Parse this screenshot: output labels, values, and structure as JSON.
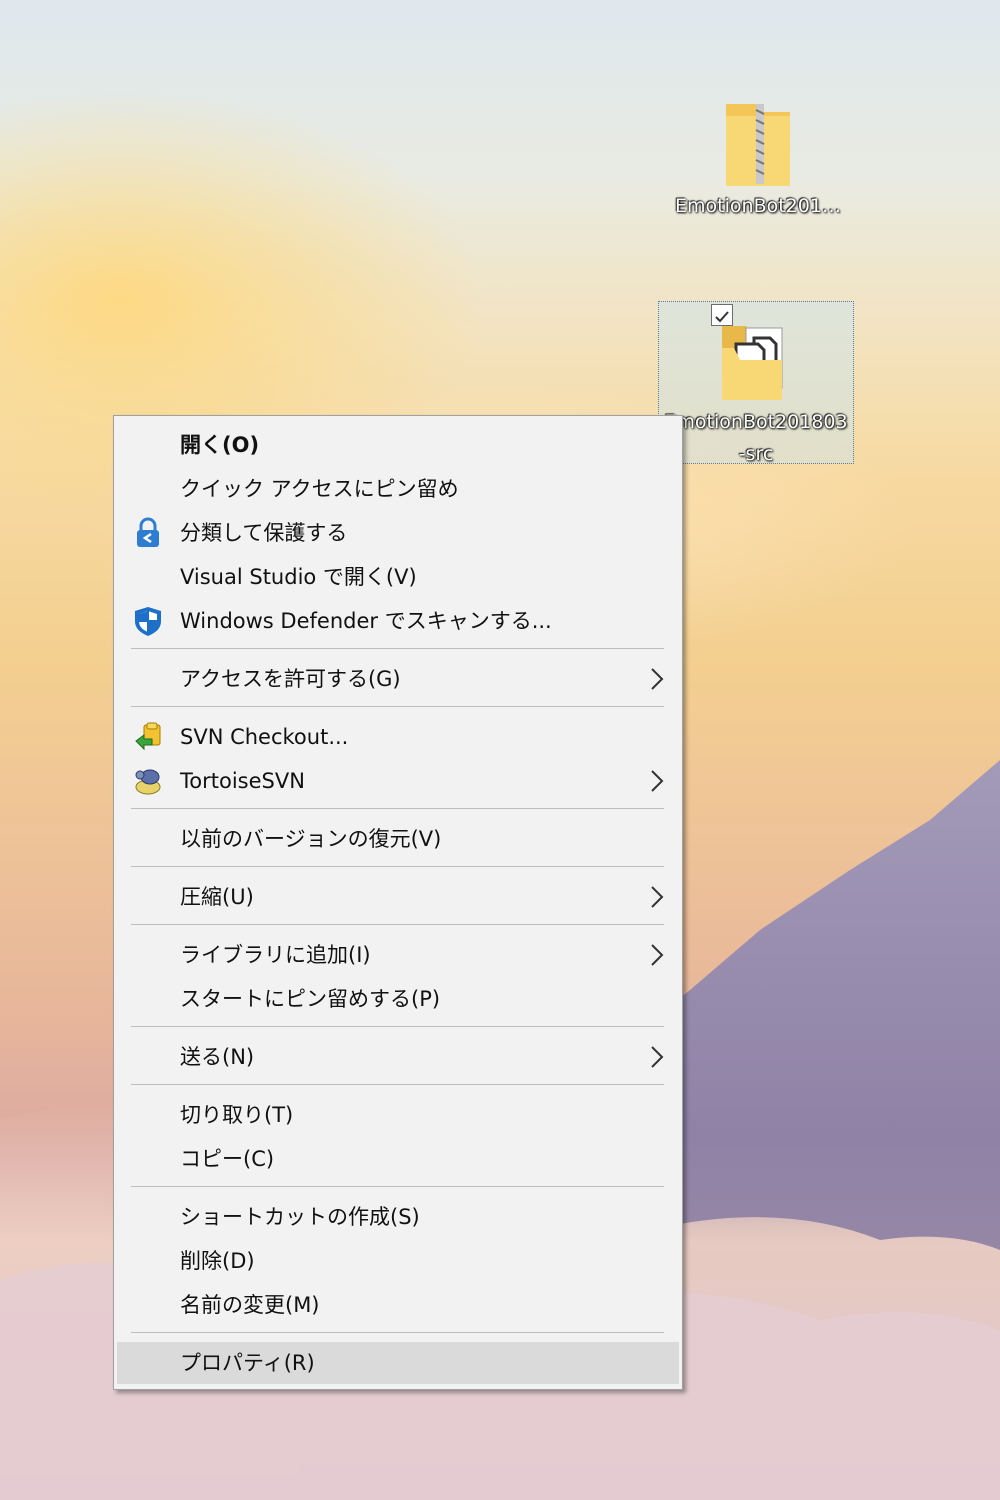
{
  "desktop": {
    "icons": [
      {
        "label": "EmotionBot201…",
        "type": "zip-folder-icon"
      },
      {
        "label": "EmotionBot201803-src",
        "type": "folder-icon",
        "selected": true,
        "checked": true
      }
    ]
  },
  "context_menu": {
    "items": [
      {
        "label": "開く(O)",
        "icon": null,
        "bold": true
      },
      {
        "label": "クイック アクセスにピン留め",
        "icon": null
      },
      {
        "label": "分類して保護する",
        "icon": "lock-protect-icon"
      },
      {
        "label": "Visual Studio で開く(V)",
        "icon": null
      },
      {
        "label": "Windows Defender でスキャンする...",
        "icon": "shield-icon"
      },
      {
        "label": "アクセスを許可する(G)",
        "submenu": true
      },
      {
        "label": "SVN Checkout...",
        "icon": "svn-checkout-icon"
      },
      {
        "label": "TortoiseSVN",
        "icon": "tortoisesvn-icon",
        "submenu": true
      },
      {
        "label": "以前のバージョンの復元(V)"
      },
      {
        "label": "圧縮(U)",
        "submenu": true
      },
      {
        "label": "ライブラリに追加(I)",
        "submenu": true
      },
      {
        "label": "スタートにピン留めする(P)"
      },
      {
        "label": "送る(N)",
        "submenu": true
      },
      {
        "label": "切り取り(T)"
      },
      {
        "label": "コピー(C)"
      },
      {
        "label": "ショートカットの作成(S)"
      },
      {
        "label": "削除(D)"
      },
      {
        "label": "名前の変更(M)"
      },
      {
        "label": "プロパティ(R)",
        "highlighted": true
      }
    ]
  },
  "colors": {
    "menu_bg": "#f2f2f2",
    "menu_hover": "#dadada",
    "separator": "#bdbdbd",
    "folder_yellow": "#f8d775",
    "selection": "#cce8ff"
  }
}
